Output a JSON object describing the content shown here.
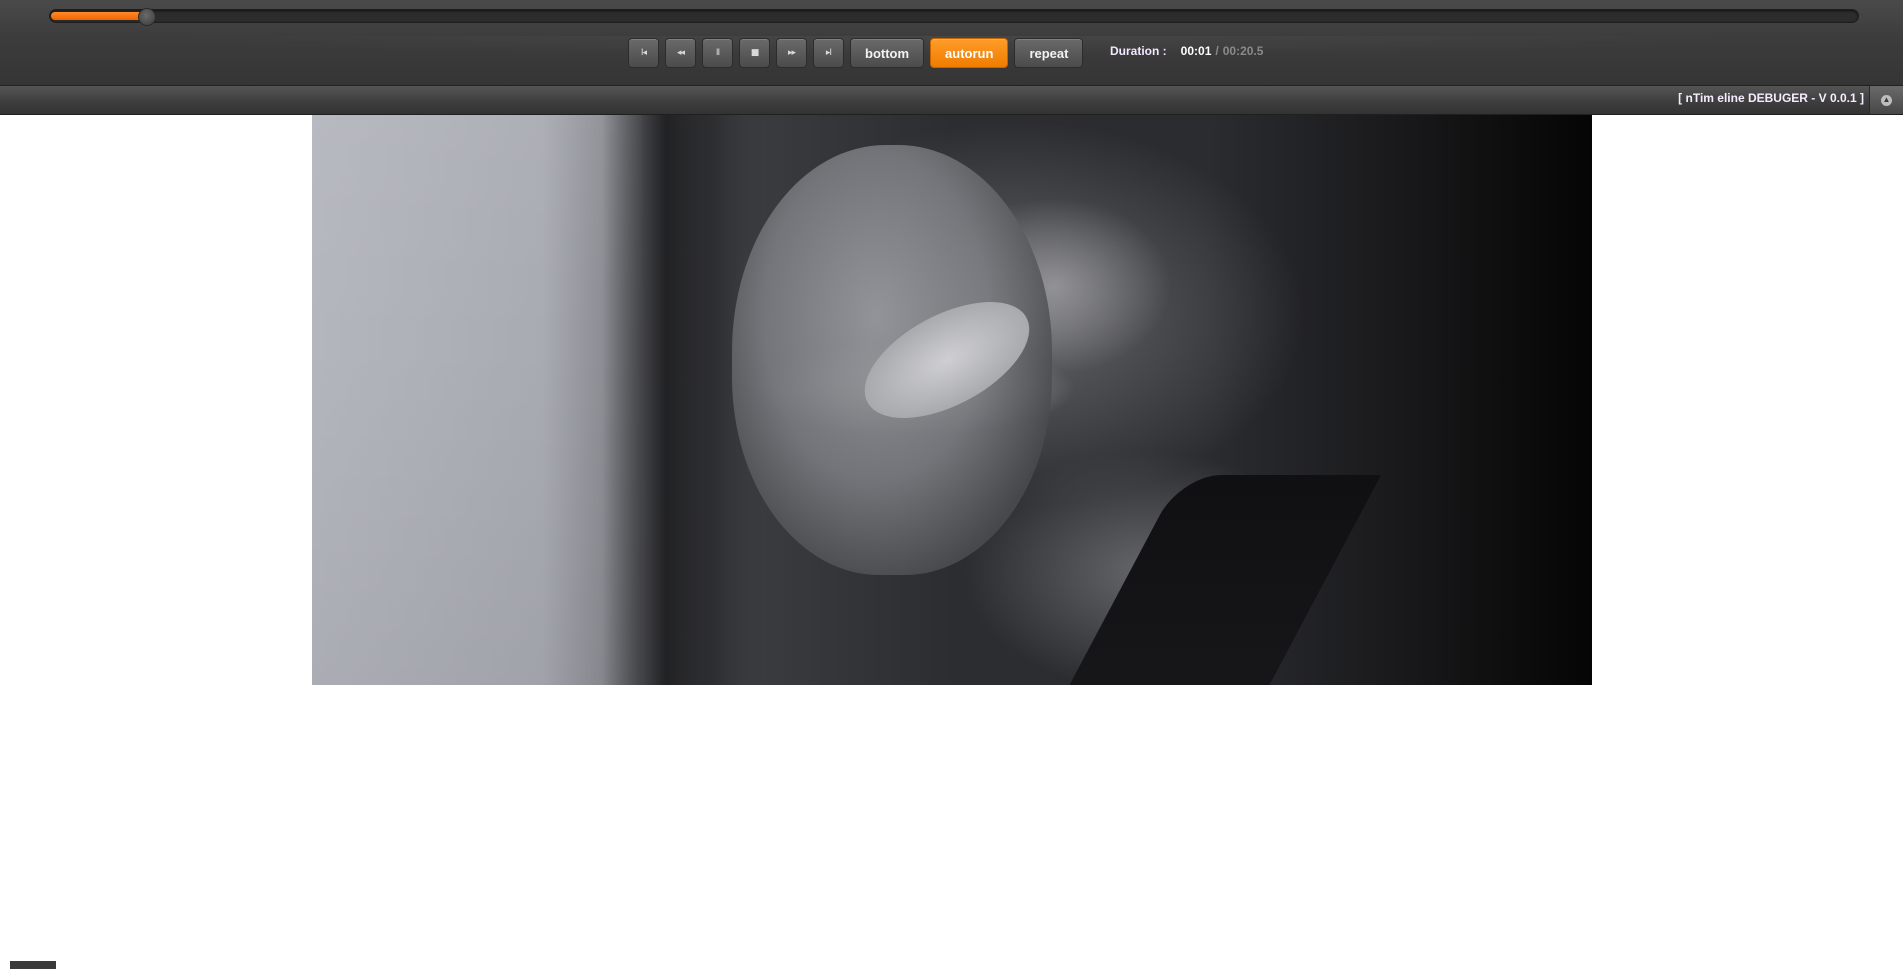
{
  "player": {
    "progress_fraction": 0.053,
    "transport_buttons": [
      {
        "name": "first-button",
        "icon": "skip-to-start-icon",
        "glyph": "I◂"
      },
      {
        "name": "rewind-button",
        "icon": "rewind-icon",
        "glyph": "◂◂"
      },
      {
        "name": "pause-button",
        "icon": "pause-icon",
        "glyph": "II"
      },
      {
        "name": "stop-button",
        "icon": "stop-icon",
        "glyph": "■"
      },
      {
        "name": "forward-button",
        "icon": "fast-forward-icon",
        "glyph": "▸▸"
      },
      {
        "name": "last-button",
        "icon": "skip-to-end-icon",
        "glyph": "▸I"
      }
    ],
    "toggles": {
      "bottom_label": "bottom",
      "autorun_label": "autorun",
      "repeat_label": "repeat",
      "active": "autorun"
    },
    "duration": {
      "label": "Duration :",
      "current": "00:01",
      "separator": "/",
      "total": "00:20.5"
    }
  },
  "debugger": {
    "title": "[ nTim eline DEBUGER - V 0.0.1 ]",
    "collapse_icon": "collapse-up-icon"
  },
  "colors": {
    "accent": "#f07d00",
    "bar": "#3c3c3c"
  }
}
